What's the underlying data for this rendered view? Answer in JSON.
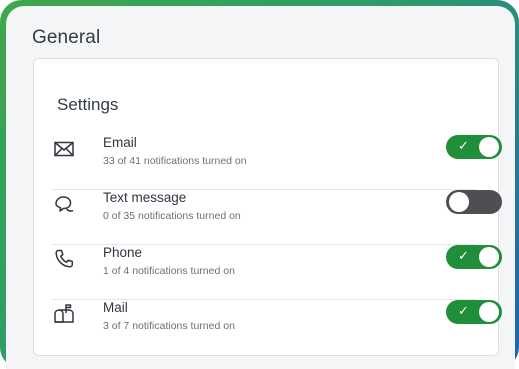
{
  "panel": {
    "title": "General"
  },
  "settings": {
    "title": "Settings",
    "items": [
      {
        "icon": "envelope-icon",
        "label": "Email",
        "subtitle": "33 of 41 notifications turned on",
        "enabled": true,
        "check": "✓"
      },
      {
        "icon": "chat-bubbles-icon",
        "label": "Text message",
        "subtitle": "0 of 35 notifications turned on",
        "enabled": false,
        "check": ""
      },
      {
        "icon": "phone-icon",
        "label": "Phone",
        "subtitle": "1 of 4 notifications turned on",
        "enabled": true,
        "check": "✓"
      },
      {
        "icon": "mailbox-icon",
        "label": "Mail",
        "subtitle": "3 of 7 notifications turned on",
        "enabled": true,
        "check": "✓"
      }
    ]
  },
  "colors": {
    "toggle_on": "#1f8f39",
    "toggle_off": "#4d4f52",
    "frame_gradient_start": "#3ea84a",
    "frame_gradient_end": "#1f63b0"
  }
}
